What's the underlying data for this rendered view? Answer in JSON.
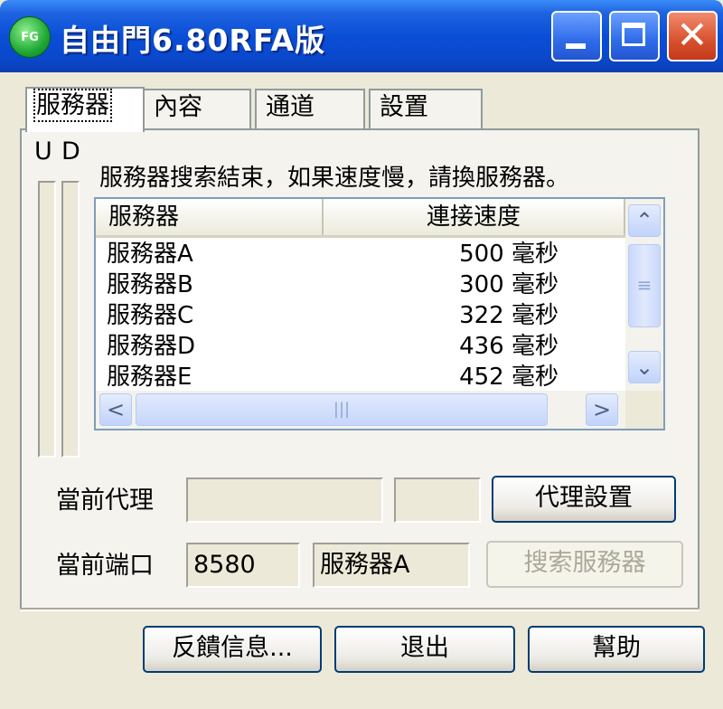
{
  "window": {
    "title": "自由門6.80RFA版",
    "icon_text": "FG",
    "close_glyph": "✕"
  },
  "tabs": [
    {
      "label": "服務器",
      "active": true
    },
    {
      "label": "內容",
      "active": false
    },
    {
      "label": "通道",
      "active": false
    },
    {
      "label": "設置",
      "active": false
    }
  ],
  "meters": {
    "up_label": "U",
    "down_label": "D"
  },
  "status_message": "服務器搜索結束，如果速度慢，請換服務器。",
  "server_list": {
    "columns": [
      "服務器",
      "連接速度"
    ],
    "rows": [
      {
        "name": "服務器A",
        "speed": "500 毫秒"
      },
      {
        "name": "服務器B",
        "speed": "300 毫秒"
      },
      {
        "name": "服務器C",
        "speed": "322 毫秒"
      },
      {
        "name": "服務器D",
        "speed": "436 毫秒"
      },
      {
        "name": "服務器E",
        "speed": "452 毫秒"
      }
    ]
  },
  "scrollbar": {
    "up": "⌃",
    "down": "⌄",
    "left": "<",
    "right": ">",
    "grip": "|||",
    "vgrip": "≡"
  },
  "proxy": {
    "label": "當前代理",
    "address": "",
    "extra": "",
    "settings_button": "代理設置"
  },
  "port": {
    "label": "當前端口",
    "value": "8580",
    "server": "服務器A",
    "search_button": "搜索服務器"
  },
  "footer": {
    "feedback_button": "反饋信息...",
    "exit_button": "退出",
    "help_button": "幫助"
  },
  "colors": {
    "titlebar": "#0A4ED6",
    "close_button": "#D8512E",
    "dialog_bg": "#ECE9D8"
  }
}
